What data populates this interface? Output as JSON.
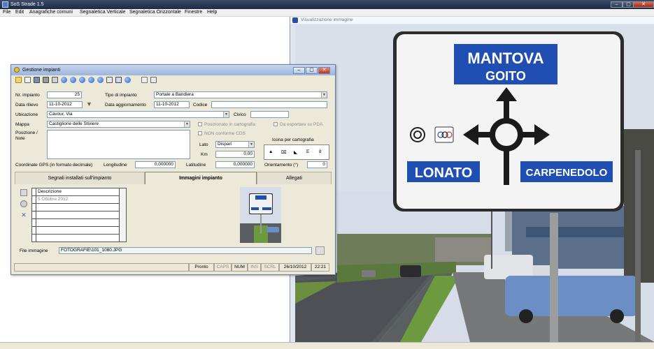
{
  "app": {
    "title": "SoS Strade 1.5"
  },
  "window_controls": {
    "minimize": "–",
    "maximize": "▢",
    "close": "✕"
  },
  "menu": [
    "File",
    "Edit",
    "Anagrafiche comuni",
    "Segnaletica Verticale",
    "Segnaletica Orizzontale",
    "Finestre",
    "Help"
  ],
  "viewer": {
    "title": "Visualizzazione immagine"
  },
  "photo_sign": {
    "top_line1": "MANTOVA",
    "top_line2": "GOITO",
    "left": "LONATO",
    "right": "CARPENEDOLO"
  },
  "gestione": {
    "title": "Gestione impianti",
    "nr_impianto_label": "Nr. impianto",
    "nr_impianto": "25",
    "tipo_label": "Tipo di impianto",
    "tipo": "Portale a Bandiera",
    "data_rilievo_label": "Data rilievo",
    "data_rilievo": "11-10-2012",
    "data_agg_label": "Data aggiornamento",
    "data_agg": "11-10-2012",
    "codice_label": "Codice",
    "codice": "",
    "ubicazione_label": "Ubicazione",
    "ubicazione": "Cavour, Via",
    "civico_label": "Civico",
    "civico": "",
    "mappa_label": "Mappa",
    "mappa": "Castiglione delle Stiviere",
    "posizione_label_1": "Posizione /",
    "posizione_label_2": "Note",
    "chk_pos_carto": "Posizionato in cartografia",
    "chk_non_conforme": "NON conforme CDS",
    "chk_esportare": "Da esportare su PDA",
    "lato_label": "Lato",
    "lato": "Dispari",
    "km_label": "Km",
    "km": "0,00",
    "icona_label": "Icona per cartografia",
    "icona_options": [
      "▲",
      "⌧",
      "◣",
      "E",
      "8"
    ],
    "gps_label": "Coordinate GPS (in formato decimale)",
    "longitudine_label": "Longitudine",
    "longitudine": "0,000000",
    "latitudine_label": "Latitudine",
    "latitudine": "0,000000",
    "orientamento_label": "Orientamento (°)",
    "orientamento": "0",
    "tabs": [
      "Segnali installati sull'impianto",
      "Immagini impianto",
      "Allegati"
    ],
    "grid_header": "Descrizione",
    "grid_rows": [
      "5 Ottobre 2012",
      "",
      "",
      "",
      "",
      ""
    ],
    "file_label": "File immagine",
    "file": "FOTOGRAFIE\\101_1080.JPG",
    "status": [
      "Pronto",
      "CAPS",
      "NUM",
      "INS",
      "SCRL",
      "26/10/2012",
      "22:21"
    ]
  },
  "colors": {
    "sign_blue": "#1f4fb2",
    "sign_bg": "#f4f4f4",
    "titlebar": "#1d2a42"
  }
}
